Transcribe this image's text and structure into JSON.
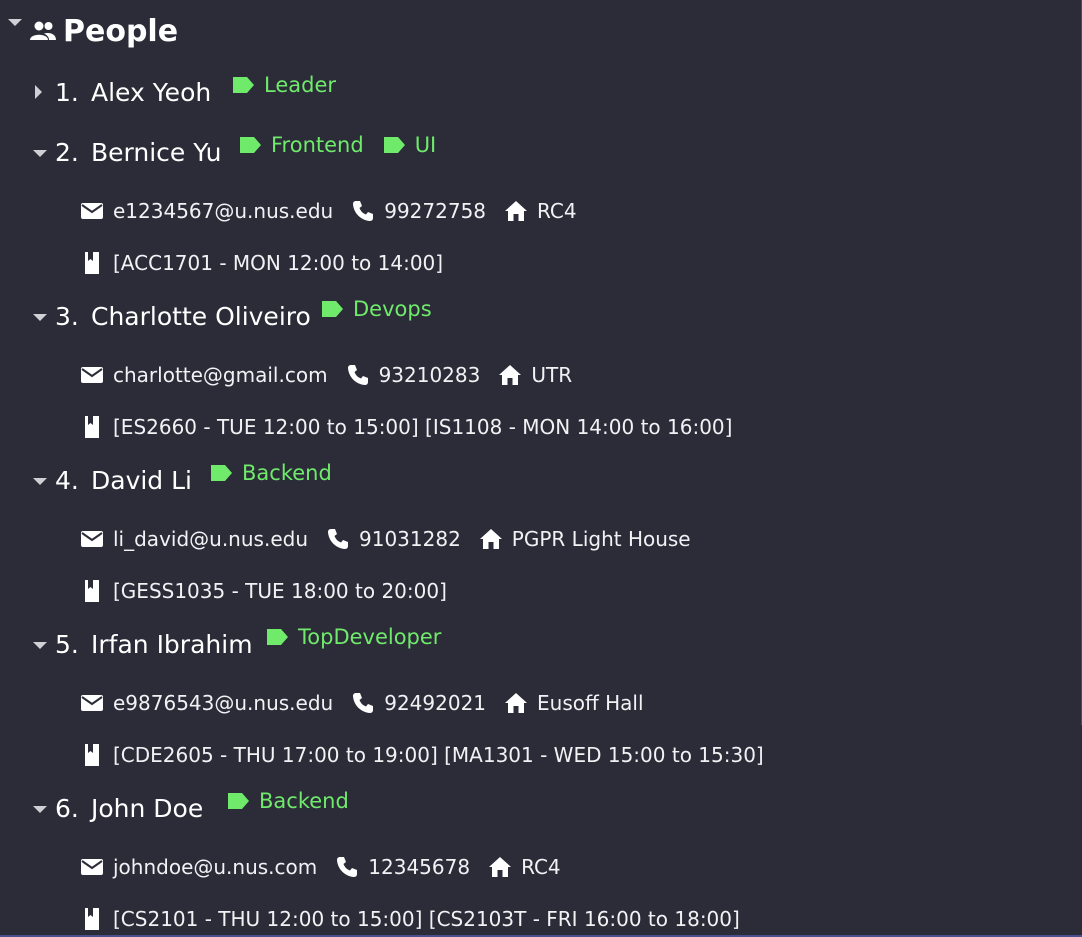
{
  "section": {
    "title": "People",
    "icon": "people-icon"
  },
  "colors": {
    "background": "#2b2c38",
    "tag": "#6fea6b",
    "text": "#ffffff"
  },
  "people": [
    {
      "index": "1.",
      "name": "Alex Yeoh",
      "expanded": false,
      "tags": [
        "Leader"
      ]
    },
    {
      "index": "2.",
      "name": "Bernice Yu",
      "expanded": true,
      "tags": [
        "Frontend",
        "UI"
      ],
      "email": "e1234567@u.nus.edu",
      "phone": "99272758",
      "address": "RC4",
      "classes": "[ACC1701 - MON 12:00 to 14:00]"
    },
    {
      "index": "3.",
      "name": "Charlotte Oliveiro",
      "expanded": true,
      "tags": [
        "Devops"
      ],
      "email": "charlotte@gmail.com",
      "phone": "93210283",
      "address": "UTR",
      "classes": "[ES2660 - TUE 12:00 to 15:00] [IS1108 - MON 14:00 to 16:00]"
    },
    {
      "index": "4.",
      "name": "David Li",
      "expanded": true,
      "tags": [
        "Backend"
      ],
      "email": "li_david@u.nus.edu",
      "phone": "91031282",
      "address": "PGPR Light House",
      "classes": "[GESS1035 - TUE 18:00 to 20:00]"
    },
    {
      "index": "5.",
      "name": "Irfan Ibrahim",
      "expanded": true,
      "tags": [
        "TopDeveloper"
      ],
      "email": "e9876543@u.nus.edu",
      "phone": "92492021",
      "address": "Eusoff Hall",
      "classes": "[CDE2605 - THU 17:00 to 19:00] [MA1301 - WED 15:00 to 15:30]"
    },
    {
      "index": "6.",
      "name": "John Doe",
      "expanded": true,
      "tags": [
        "Backend"
      ],
      "email": "johndoe@u.nus.com",
      "phone": "12345678",
      "address": "RC4",
      "classes": "[CS2101 - THU 12:00 to 15:00] [CS2103T - FRI 16:00 to 18:00]"
    }
  ]
}
